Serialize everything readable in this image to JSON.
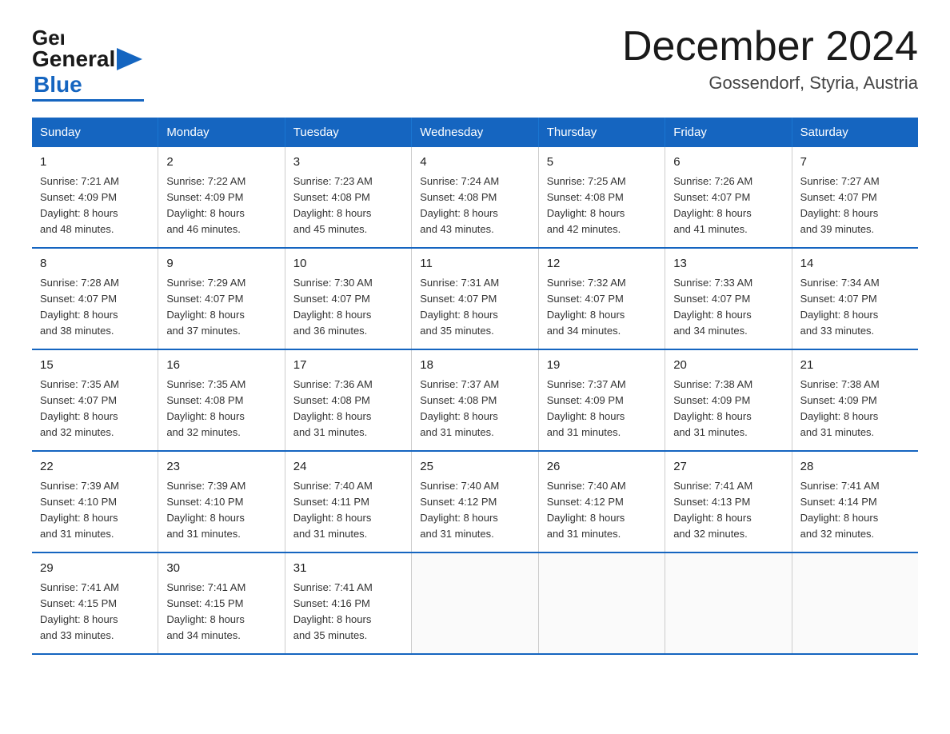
{
  "header": {
    "title": "December 2024",
    "subtitle": "Gossendorf, Styria, Austria",
    "logo": {
      "general": "General",
      "blue": "Blue"
    }
  },
  "days_of_week": [
    "Sunday",
    "Monday",
    "Tuesday",
    "Wednesday",
    "Thursday",
    "Friday",
    "Saturday"
  ],
  "weeks": [
    [
      {
        "day": "1",
        "sunrise": "7:21 AM",
        "sunset": "4:09 PM",
        "daylight": "8 hours and 48 minutes."
      },
      {
        "day": "2",
        "sunrise": "7:22 AM",
        "sunset": "4:09 PM",
        "daylight": "8 hours and 46 minutes."
      },
      {
        "day": "3",
        "sunrise": "7:23 AM",
        "sunset": "4:08 PM",
        "daylight": "8 hours and 45 minutes."
      },
      {
        "day": "4",
        "sunrise": "7:24 AM",
        "sunset": "4:08 PM",
        "daylight": "8 hours and 43 minutes."
      },
      {
        "day": "5",
        "sunrise": "7:25 AM",
        "sunset": "4:08 PM",
        "daylight": "8 hours and 42 minutes."
      },
      {
        "day": "6",
        "sunrise": "7:26 AM",
        "sunset": "4:07 PM",
        "daylight": "8 hours and 41 minutes."
      },
      {
        "day": "7",
        "sunrise": "7:27 AM",
        "sunset": "4:07 PM",
        "daylight": "8 hours and 39 minutes."
      }
    ],
    [
      {
        "day": "8",
        "sunrise": "7:28 AM",
        "sunset": "4:07 PM",
        "daylight": "8 hours and 38 minutes."
      },
      {
        "day": "9",
        "sunrise": "7:29 AM",
        "sunset": "4:07 PM",
        "daylight": "8 hours and 37 minutes."
      },
      {
        "day": "10",
        "sunrise": "7:30 AM",
        "sunset": "4:07 PM",
        "daylight": "8 hours and 36 minutes."
      },
      {
        "day": "11",
        "sunrise": "7:31 AM",
        "sunset": "4:07 PM",
        "daylight": "8 hours and 35 minutes."
      },
      {
        "day": "12",
        "sunrise": "7:32 AM",
        "sunset": "4:07 PM",
        "daylight": "8 hours and 34 minutes."
      },
      {
        "day": "13",
        "sunrise": "7:33 AM",
        "sunset": "4:07 PM",
        "daylight": "8 hours and 34 minutes."
      },
      {
        "day": "14",
        "sunrise": "7:34 AM",
        "sunset": "4:07 PM",
        "daylight": "8 hours and 33 minutes."
      }
    ],
    [
      {
        "day": "15",
        "sunrise": "7:35 AM",
        "sunset": "4:07 PM",
        "daylight": "8 hours and 32 minutes."
      },
      {
        "day": "16",
        "sunrise": "7:35 AM",
        "sunset": "4:08 PM",
        "daylight": "8 hours and 32 minutes."
      },
      {
        "day": "17",
        "sunrise": "7:36 AM",
        "sunset": "4:08 PM",
        "daylight": "8 hours and 31 minutes."
      },
      {
        "day": "18",
        "sunrise": "7:37 AM",
        "sunset": "4:08 PM",
        "daylight": "8 hours and 31 minutes."
      },
      {
        "day": "19",
        "sunrise": "7:37 AM",
        "sunset": "4:09 PM",
        "daylight": "8 hours and 31 minutes."
      },
      {
        "day": "20",
        "sunrise": "7:38 AM",
        "sunset": "4:09 PM",
        "daylight": "8 hours and 31 minutes."
      },
      {
        "day": "21",
        "sunrise": "7:38 AM",
        "sunset": "4:09 PM",
        "daylight": "8 hours and 31 minutes."
      }
    ],
    [
      {
        "day": "22",
        "sunrise": "7:39 AM",
        "sunset": "4:10 PM",
        "daylight": "8 hours and 31 minutes."
      },
      {
        "day": "23",
        "sunrise": "7:39 AM",
        "sunset": "4:10 PM",
        "daylight": "8 hours and 31 minutes."
      },
      {
        "day": "24",
        "sunrise": "7:40 AM",
        "sunset": "4:11 PM",
        "daylight": "8 hours and 31 minutes."
      },
      {
        "day": "25",
        "sunrise": "7:40 AM",
        "sunset": "4:12 PM",
        "daylight": "8 hours and 31 minutes."
      },
      {
        "day": "26",
        "sunrise": "7:40 AM",
        "sunset": "4:12 PM",
        "daylight": "8 hours and 31 minutes."
      },
      {
        "day": "27",
        "sunrise": "7:41 AM",
        "sunset": "4:13 PM",
        "daylight": "8 hours and 32 minutes."
      },
      {
        "day": "28",
        "sunrise": "7:41 AM",
        "sunset": "4:14 PM",
        "daylight": "8 hours and 32 minutes."
      }
    ],
    [
      {
        "day": "29",
        "sunrise": "7:41 AM",
        "sunset": "4:15 PM",
        "daylight": "8 hours and 33 minutes."
      },
      {
        "day": "30",
        "sunrise": "7:41 AM",
        "sunset": "4:15 PM",
        "daylight": "8 hours and 34 minutes."
      },
      {
        "day": "31",
        "sunrise": "7:41 AM",
        "sunset": "4:16 PM",
        "daylight": "8 hours and 35 minutes."
      },
      null,
      null,
      null,
      null
    ]
  ],
  "labels": {
    "sunrise_prefix": "Sunrise: ",
    "sunset_prefix": "Sunset: ",
    "daylight_prefix": "Daylight: "
  }
}
